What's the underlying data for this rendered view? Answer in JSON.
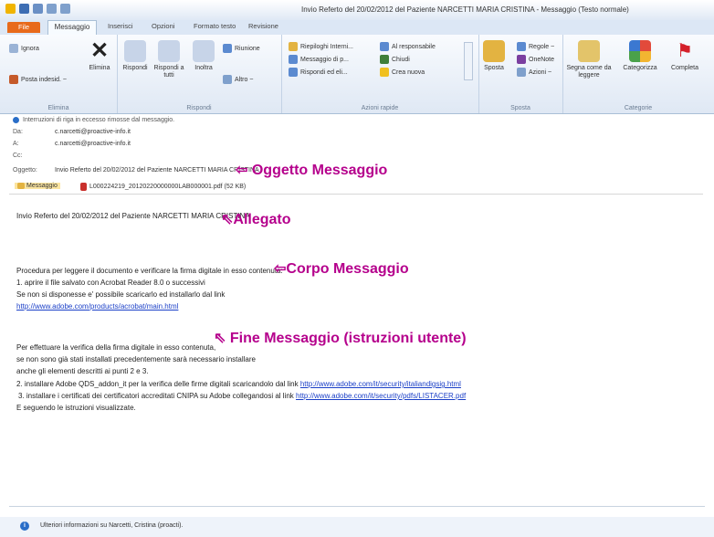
{
  "window": {
    "title": "Invio Referto del 20/02/2012 del Paziente NARCETTI MARIA CRISTINA - Messaggio (Testo normale)"
  },
  "tabs": [
    "File",
    "Messaggio",
    "Inserisci",
    "Opzioni",
    "Formato testo",
    "Revisione"
  ],
  "ribbon": {
    "elimina": {
      "ignora": "Ignora",
      "posta_indesid": "Posta indesid. ~",
      "elimina": "Elimina",
      "group": "Elimina"
    },
    "rispondi": {
      "rispondi": "Rispondi",
      "rispondi_tutti": "Rispondi a tutti",
      "inoltra": "Inoltra",
      "riunione": "Riunione",
      "altro": "Altro ~",
      "group": "Rispondi"
    },
    "azioni_rapide": {
      "riepiloghi": "Riepiloghi Interni...",
      "messaggio": "Messaggio di p...",
      "rispondi_el": "Rispondi ed eli...",
      "al_responsabile": "Al responsabile",
      "chiudi": "Chiudi",
      "crea_nuova": "Crea nuova",
      "group": "Azioni rapide"
    },
    "sposta": {
      "sposta": "Sposta",
      "regole": "Regole ~",
      "onenote": "OneNote",
      "azioni": "Azioni ~",
      "group": "Sposta"
    },
    "categorie": {
      "segna": "Segna come da leggere",
      "categorizza": "Categorizza",
      "completa": "Completa",
      "group": "Categorie"
    }
  },
  "header": {
    "info": "Interruzioni di riga in eccesso rimosse dal messaggio.",
    "da_label": "Da:",
    "da": "c.narcetti@proactive-info.it",
    "a_label": "A:",
    "a": "c.narcetti@proactive-info.it",
    "cc_label": "Cc:",
    "oggetto_label": "Oggetto:",
    "oggetto": "Invio Referto del 20/02/2012 del Paziente NARCETTI MARIA CRISTINA"
  },
  "attachments": {
    "messaggio": "Messaggio",
    "file": "L000224219_20120220000000LAB000001.pdf (52 KB)"
  },
  "body": {
    "l1": "Invio Referto del 20/02/2012 del Paziente NARCETTI MARIA CRISTINA",
    "l2": "Procedura per leggere il documento e verificare la firma digitale in esso contenuta:",
    "l3": "1. aprire il file salvato con Acrobat Reader 8.0 o successivi",
    "l4": "Se non si disponesse e' possibile scaricarlo ed installarlo dal link",
    "link1": "http://www.adobe.com/products/acrobat/main.html",
    "l5": "Per effettuare la verifica della firma digitale in esso contenuta,",
    "l6": "se non sono già stati installati precedentemente sarà necessario installare",
    "l7": "anche gli elementi descritti ai punti 2 e 3.",
    "l8": "2. installare Adobe QDS_addon_it per la verifica delle firme digitali scaricandolo dal link",
    "link2": "http://www.adobe.com/it/security/italiandigsig.html",
    "l9": "3. installare i certificati dei certificatori accreditati CNIPA su Adobe collegandosi al link",
    "link3": "http://www.adobe.com/it/security/pdfs/LISTACER.pdf",
    "l10": "E seguendo le istruzioni visualizzate."
  },
  "annotations": {
    "oggetto": "⇦ Oggetto Messaggio",
    "allegato": "⇖Allegato",
    "corpo": "⇦Corpo Messaggio",
    "fine": "⇖ Fine Messaggio (istruzioni utente)"
  },
  "footer": {
    "info": "Ulteriori informazioni su Narcetti, Cristina (proacti)."
  },
  "colors": {
    "accent": "#e86a1b",
    "annotation": "#b5008c",
    "link": "#1a3fc7"
  }
}
